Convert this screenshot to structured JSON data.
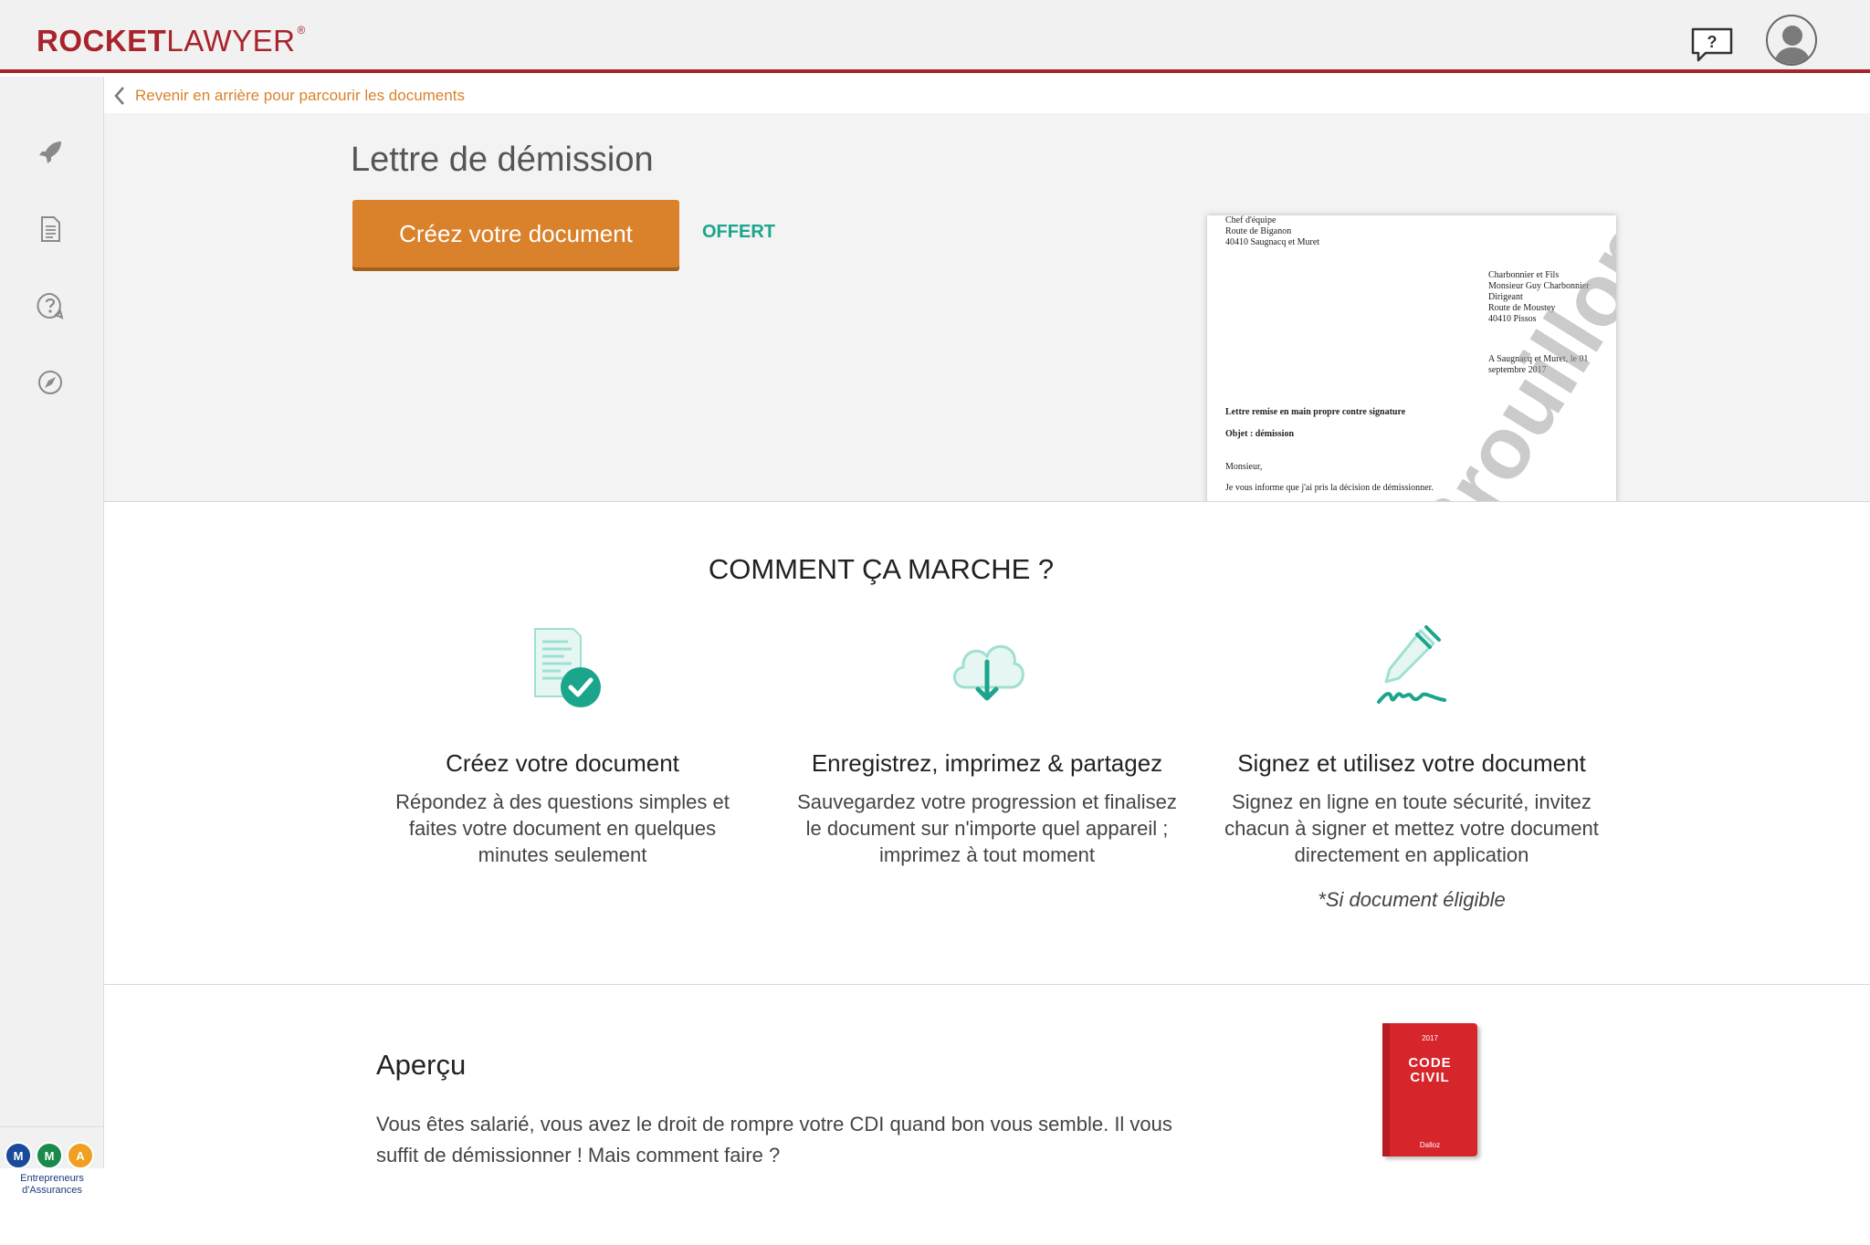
{
  "brand": {
    "rocket": "ROCKET",
    "lawyer": "LAWYER",
    "reg": "®",
    "color": "#a8232a"
  },
  "header": {
    "help_label": "?"
  },
  "breadcrumb": {
    "back_label": "Revenir en arrière pour parcourir les documents"
  },
  "document": {
    "title": "Lettre de démission",
    "cta_label": "Créez votre document",
    "price_label": "OFFERT",
    "preview": {
      "sender": [
        "Chef d'équipe",
        "Route de Biganon",
        "40410 Saugnacq et Muret"
      ],
      "recipient": [
        "Charbonnier et Fils",
        "Monsieur  Guy Charbonnier",
        "Dirigeant",
        "Route de Moustey",
        "40410 Pissos"
      ],
      "date": [
        "A Saugnacq et Muret, le 01",
        "septembre 2017"
      ],
      "remise": "Lettre remise en main propre contre signature",
      "objet": "Objet : démission",
      "salutation": "Monsieur,",
      "body": "Je vous informe que j'ai pris la décision de démissionner.",
      "watermark": "Brouillon"
    }
  },
  "how": {
    "title": "COMMENT ÇA MARCHE ?",
    "steps": [
      {
        "icon": "document-check-icon",
        "title": "Créez votre document",
        "desc": [
          "Répondez à des questions simples et",
          "faites votre document en quelques",
          "minutes seulement"
        ]
      },
      {
        "icon": "cloud-download-icon",
        "title": "Enregistrez, imprimez & partagez",
        "desc": [
          "Sauvegardez votre progression et finalisez",
          "le document sur n'importe quel appareil ;",
          "imprimez à tout moment"
        ]
      },
      {
        "icon": "pen-signature-icon",
        "title": "Signez et utilisez votre document",
        "desc": [
          "Signez en ligne en toute sécurité, invitez",
          "chacun à signer et mettez votre document",
          "directement en application"
        ],
        "note": "*Si document éligible"
      }
    ]
  },
  "apercu": {
    "title": "Aperçu",
    "text": [
      "Vous êtes salarié, vous avez le droit de rompre votre CDI quand bon vous semble. Il vous",
      "suffit de démissionner ! Mais comment faire ?"
    ],
    "book": {
      "year": "2017",
      "title_lines": [
        "CODE",
        "CIVIL"
      ],
      "publisher": "Dalloz"
    }
  },
  "partner": {
    "badges": [
      "M",
      "M",
      "A"
    ],
    "text": [
      "Entrepreneurs",
      "d'Assurances"
    ]
  },
  "colors": {
    "accent_orange": "#d9822b",
    "green": "#1aa58c",
    "sidebar_bg": "#f1f1f1",
    "hero_bg": "#f3f3f3"
  }
}
